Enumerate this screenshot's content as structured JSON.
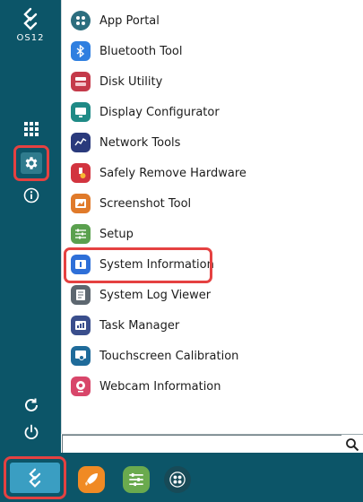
{
  "logo": {
    "text": "OS12"
  },
  "sidebar": {
    "buttons": [
      {
        "name": "apps-grid",
        "icon": "grid-icon"
      },
      {
        "name": "settings",
        "icon": "gear-icon",
        "selected": true
      },
      {
        "name": "info",
        "icon": "info-icon"
      },
      {
        "name": "refresh",
        "icon": "refresh-icon"
      },
      {
        "name": "power",
        "icon": "power-icon"
      }
    ]
  },
  "menu": {
    "items": [
      {
        "label": "App Portal",
        "icon": "app-portal-icon",
        "color": "#2c6e7f"
      },
      {
        "label": "Bluetooth Tool",
        "icon": "bluetooth-icon",
        "color": "#2f7fe0"
      },
      {
        "label": "Disk Utility",
        "icon": "disk-icon",
        "color": "#c43a4a"
      },
      {
        "label": "Display Configurator",
        "icon": "monitor-icon",
        "color": "#1f8a86"
      },
      {
        "label": "Network Tools",
        "icon": "network-icon",
        "color": "#2a3a7c"
      },
      {
        "label": "Safely Remove Hardware",
        "icon": "usb-eject-icon",
        "color": "#d2343f"
      },
      {
        "label": "Screenshot Tool",
        "icon": "screenshot-icon",
        "color": "#e07a2a"
      },
      {
        "label": "Setup",
        "icon": "sliders-icon",
        "color": "#5aa04e"
      },
      {
        "label": "System Information",
        "icon": "system-info-icon",
        "color": "#2e6fd8",
        "highlighted": true
      },
      {
        "label": "System Log Viewer",
        "icon": "log-viewer-icon",
        "color": "#5d6770"
      },
      {
        "label": "Task Manager",
        "icon": "task-manager-icon",
        "color": "#3a4e8c"
      },
      {
        "label": "Touchscreen Calibration",
        "icon": "touch-icon",
        "color": "#1f6b9a"
      },
      {
        "label": "Webcam Information",
        "icon": "webcam-icon",
        "color": "#d8466a"
      }
    ]
  },
  "search": {
    "value": "",
    "placeholder": ""
  },
  "taskbar": {
    "apps": [
      {
        "name": "launcher",
        "icon": "rocket-icon",
        "color": "#f08a24"
      },
      {
        "name": "setup",
        "icon": "sliders-icon",
        "color": "#6aaa4e"
      },
      {
        "name": "app-portal",
        "icon": "app-portal-icon",
        "color": "#174a57"
      }
    ]
  }
}
